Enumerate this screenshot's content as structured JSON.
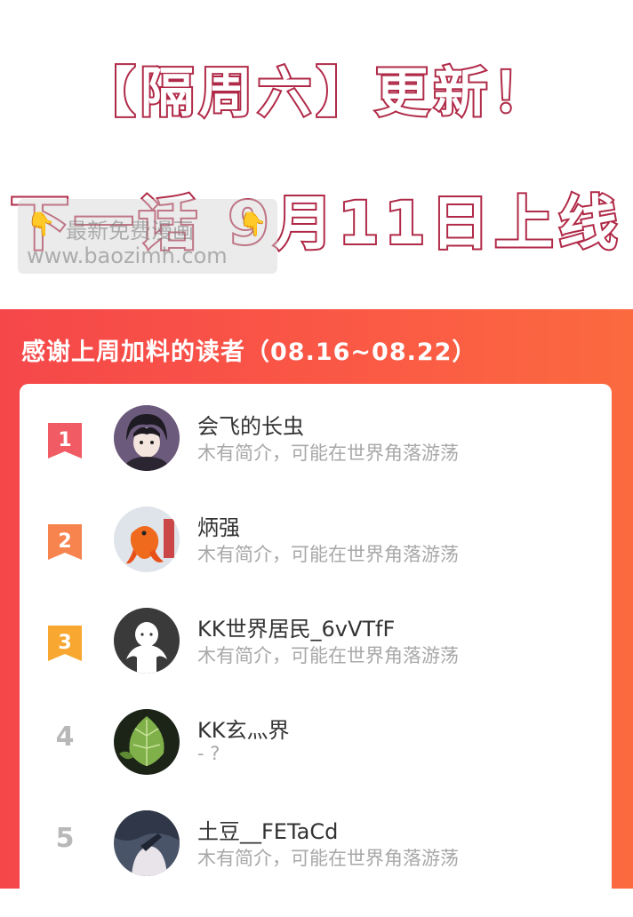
{
  "banner": {
    "line1": "【隔周六】更新！",
    "line2": "下一话 9月11日上线",
    "watermark_line1": "最新免费漫画",
    "watermark_line2": "www.baozimh.com",
    "watermark_hand": "👇"
  },
  "panel": {
    "title": "感谢上周加料的读者（08.16~08.22）",
    "colors": {
      "panel_start": "#f5474a",
      "panel_end": "#fb6a3f",
      "badge_1": "#f15b63",
      "badge_2": "#f7834f",
      "badge_3": "#f8a830"
    }
  },
  "readers": [
    {
      "rank": "1",
      "name": "会飞的长虫",
      "desc": "木有简介，可能在世界角落游荡",
      "avatar": "anime-boy-avatar"
    },
    {
      "rank": "2",
      "name": "炳强",
      "desc": "木有简介，可能在世界角落游荡",
      "avatar": "goldfish-avatar"
    },
    {
      "rank": "3",
      "name": "KK世界居民_6vVTfF",
      "desc": "木有简介，可能在世界角落游荡",
      "avatar": "default-user-avatar"
    },
    {
      "rank": "4",
      "name": "KK玄灬界",
      "desc": "- ?",
      "avatar": "leaf-avatar"
    },
    {
      "rank": "5",
      "name": "土豆__FETaCd",
      "desc": "木有简介，可能在世界角落游荡",
      "avatar": "dark-illustration-avatar"
    }
  ]
}
